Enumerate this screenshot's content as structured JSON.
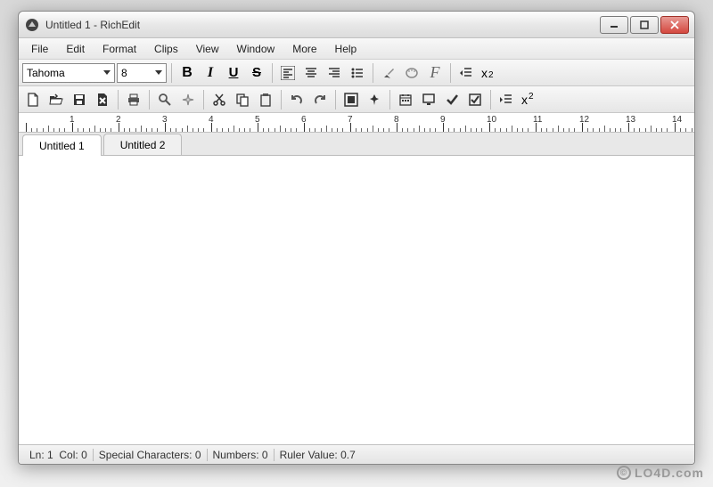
{
  "watermark": "LO4D.com",
  "window": {
    "title": "Untitled 1 - RichEdit"
  },
  "menubar": [
    "File",
    "Edit",
    "Format",
    "Clips",
    "View",
    "Window",
    "More",
    "Help"
  ],
  "toolbar1": {
    "font": "Tahoma",
    "size": "8",
    "bold": "B",
    "italic": "I",
    "underline": "U",
    "strike": "S",
    "subscript_x": "x",
    "subscript_2": "2"
  },
  "toolbar2": {
    "superscript_x": "x",
    "superscript_2": "2"
  },
  "tabs": [
    {
      "label": "Untitled 1",
      "active": true
    },
    {
      "label": "Untitled 2",
      "active": false
    }
  ],
  "ruler": {
    "start": 0,
    "end": 14
  },
  "status": {
    "line_label": "Ln:",
    "line_value": "1",
    "col_label": "Col:",
    "col_value": "0",
    "special_label": "Special Characters:",
    "special_value": "0",
    "numbers_label": "Numbers:",
    "numbers_value": "0",
    "ruler_label": "Ruler Value:",
    "ruler_value": "0.7"
  }
}
